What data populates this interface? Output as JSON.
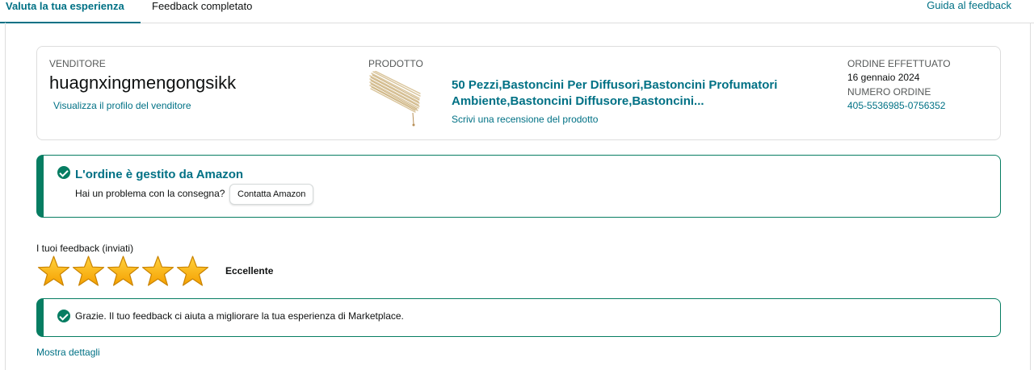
{
  "tabs": [
    {
      "label": "Valuta la tua esperienza",
      "active": true
    },
    {
      "label": "Feedback completato",
      "active": false
    }
  ],
  "help_link": "Guida al feedback",
  "order": {
    "seller_label": "VENDITORE",
    "seller_name": "huagnxingmengongsikk",
    "seller_profile_link": "Visualizza il profilo del venditore",
    "product_label": "PRODOTTO",
    "product_title": "50 Pezzi,Bastoncini Per Diffusori,Bastoncini Profumatori Ambiente,Bastoncini Diffusore,Bastoncini...",
    "product_review_link": "Scrivi una recensione del prodotto",
    "order_placed_label": "ORDINE EFFETTUATO",
    "order_date": "16 gennaio 2024",
    "order_number_label": "NUMERO ORDINE",
    "order_number": "405-5536985-0756352"
  },
  "alert": {
    "title": "L'ordine è gestito da Amazon",
    "text": "Hai un problema con la consegna?",
    "button": "Contatta Amazon"
  },
  "feedback": {
    "label": "I tuoi feedback (inviati)",
    "rating": 5,
    "max_rating": 5,
    "rating_text": "Eccellente"
  },
  "thanks_message": "Grazie. Il tuo feedback ci aiuta a migliorare la tua esperienza di Marketplace.",
  "details_link": "Mostra dettagli",
  "colors": {
    "link": "#007185",
    "success": "#067d62",
    "star": "#ffb300",
    "border": "#dddddd"
  },
  "icons": [
    "check-circle-icon",
    "star-icon",
    "product-thumbnail"
  ]
}
